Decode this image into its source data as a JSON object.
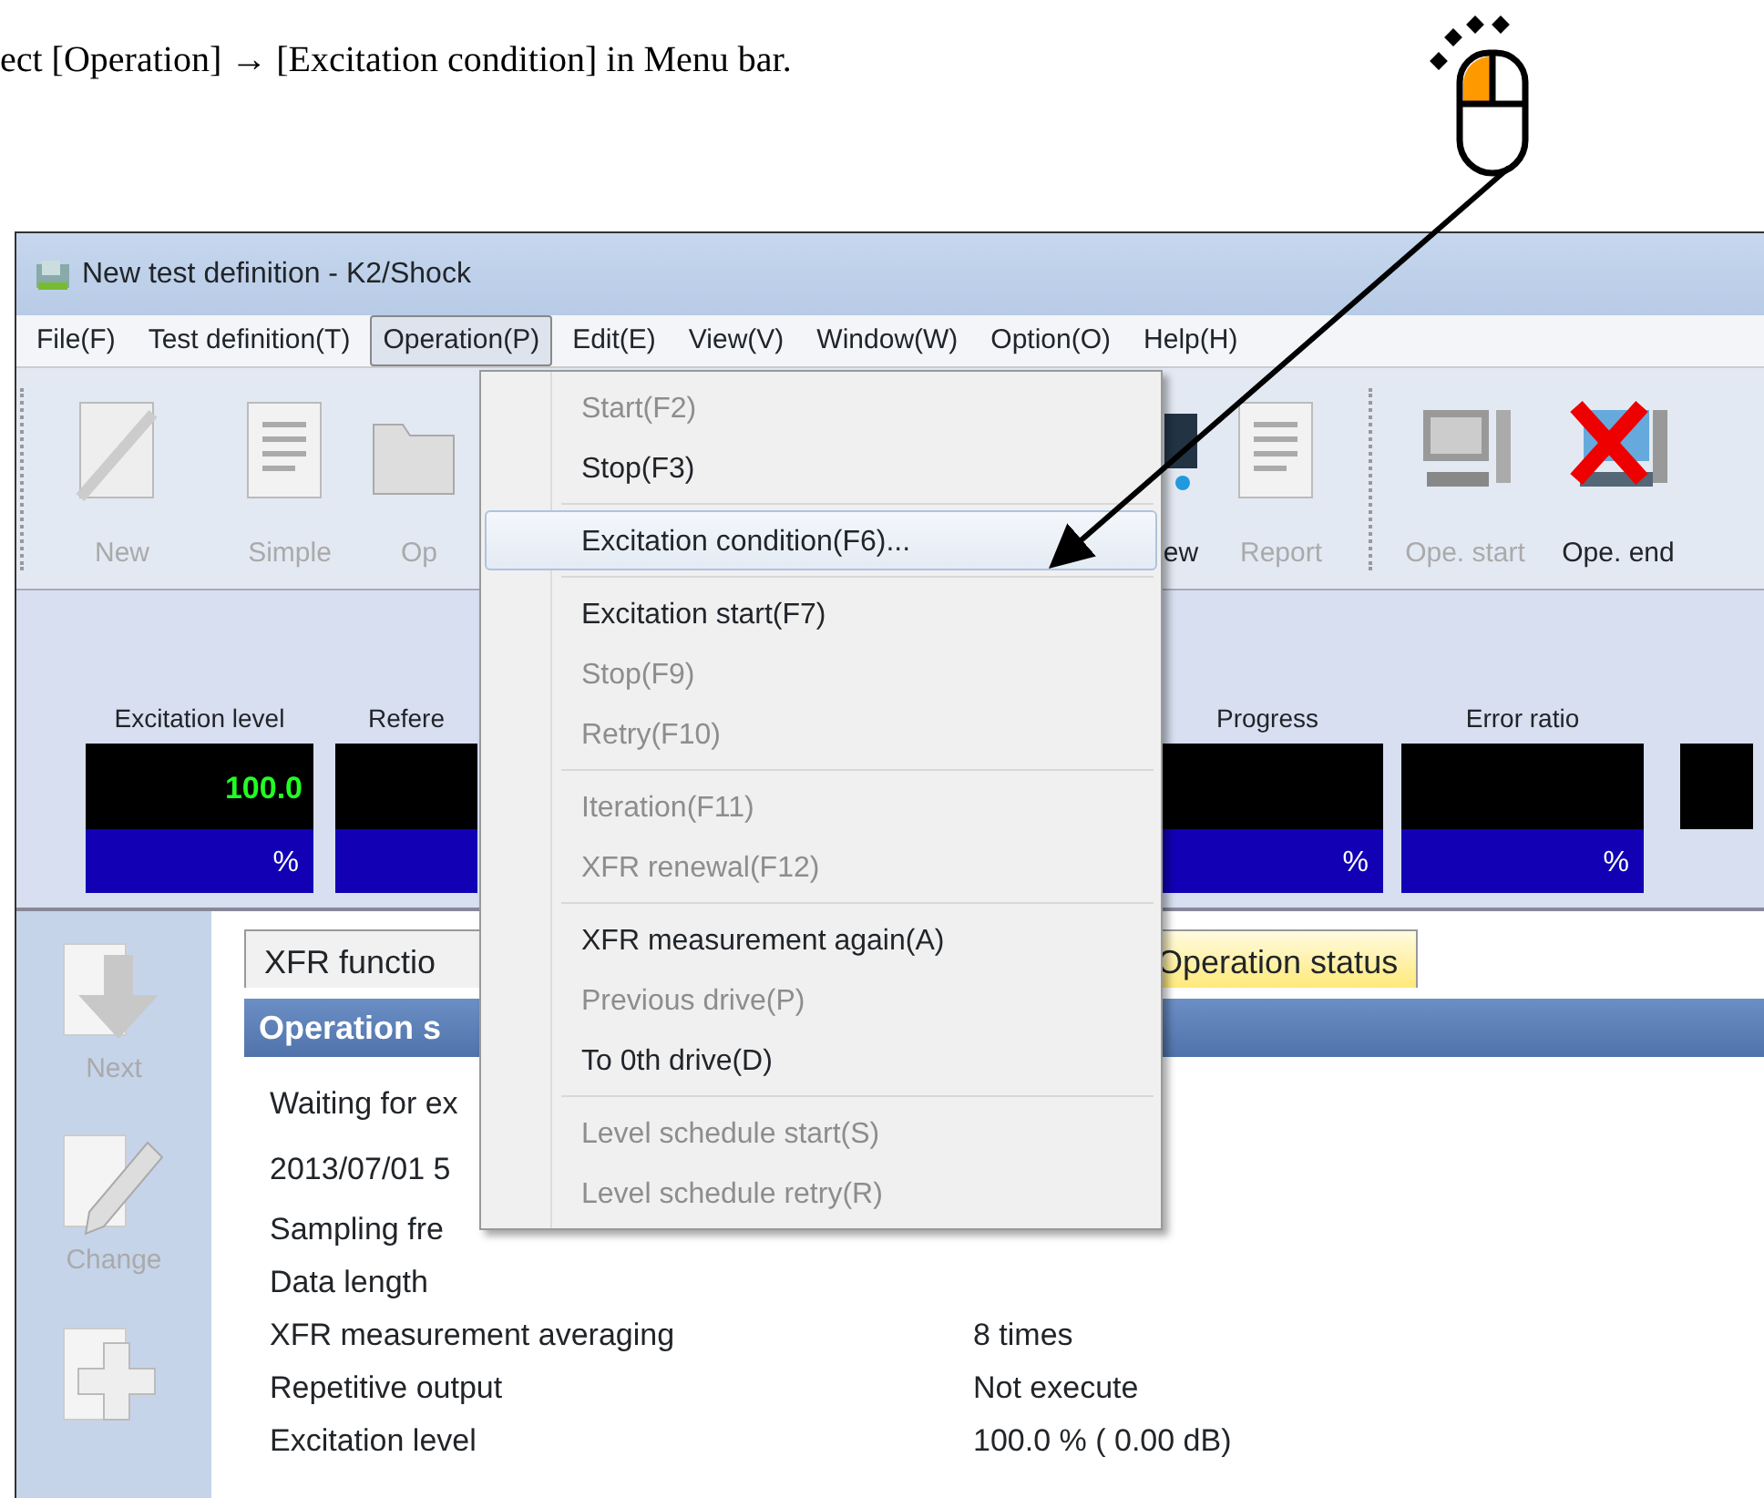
{
  "instruction": "ect [Operation] → [Excitation condition] in Menu bar.",
  "window": {
    "title": "New test definition - K2/Shock"
  },
  "menu_bar": [
    {
      "label": "File(F)",
      "selected": false
    },
    {
      "label": "Test definition(T)",
      "selected": false
    },
    {
      "label": "Operation(P)",
      "selected": true
    },
    {
      "label": "Edit(E)",
      "selected": false
    },
    {
      "label": "View(V)",
      "selected": false
    },
    {
      "label": "Window(W)",
      "selected": false
    },
    {
      "label": "Option(O)",
      "selected": false
    },
    {
      "label": "Help(H)",
      "selected": false
    }
  ],
  "toolbar": [
    {
      "label": "New",
      "disabled": true
    },
    {
      "label": "Simple",
      "disabled": true
    },
    {
      "label": "Op",
      "disabled": true
    },
    {
      "label": "ew",
      "disabled": false
    },
    {
      "label": "Report",
      "disabled": true
    },
    {
      "label": "Ope. start",
      "disabled": true
    },
    {
      "label": "Ope. end",
      "disabled": false
    }
  ],
  "meters": [
    {
      "kind": "full",
      "label": "Excitation level",
      "value": "100.0",
      "unit": "%"
    },
    {
      "kind": "blank",
      "label": "Refere"
    },
    {
      "kind": "full",
      "label": "Progress",
      "unit": "%"
    },
    {
      "kind": "full",
      "label": "Error ratio",
      "unit": "%"
    },
    {
      "kind": "display"
    }
  ],
  "sidebar": [
    {
      "label": "Next"
    },
    {
      "label": "Change"
    }
  ],
  "tabs": [
    {
      "label": "XFR functio",
      "selected": false
    },
    {
      "label": "Operation status",
      "selected": true
    }
  ],
  "panel": {
    "title": "Operation s",
    "rows": [
      {
        "label": "Waiting for ex"
      },
      {
        "label": "2013/07/01 5"
      },
      {
        "label": "Sampling fre"
      },
      {
        "label": "Data length"
      },
      {
        "label": "XFR measurement averaging",
        "value": "8 times"
      },
      {
        "label": "Repetitive output",
        "value": "Not execute"
      },
      {
        "label": "Excitation level",
        "value": "100.0 % ( 0.00 dB)"
      }
    ]
  },
  "dropdown": [
    {
      "kind": "item",
      "label": "Start(F2)",
      "disabled": true,
      "selected": false
    },
    {
      "kind": "item",
      "label": "Stop(F3)",
      "disabled": false,
      "selected": false
    },
    {
      "kind": "separator"
    },
    {
      "kind": "item",
      "label": "Excitation condition(F6)...",
      "disabled": false,
      "selected": true
    },
    {
      "kind": "separator"
    },
    {
      "kind": "item",
      "label": "Excitation start(F7)",
      "disabled": false,
      "selected": false
    },
    {
      "kind": "item",
      "label": "Stop(F9)",
      "disabled": true,
      "selected": false
    },
    {
      "kind": "item",
      "label": "Retry(F10)",
      "disabled": true,
      "selected": false
    },
    {
      "kind": "separator"
    },
    {
      "kind": "item",
      "label": "Iteration(F11)",
      "disabled": true,
      "selected": false
    },
    {
      "kind": "item",
      "label": "XFR renewal(F12)",
      "disabled": true,
      "selected": false
    },
    {
      "kind": "separator"
    },
    {
      "kind": "item",
      "label": "XFR measurement again(A)",
      "disabled": false,
      "selected": false
    },
    {
      "kind": "item",
      "label": "Previous drive(P)",
      "disabled": true,
      "selected": false
    },
    {
      "kind": "item",
      "label": "To 0th drive(D)",
      "disabled": false,
      "selected": false
    },
    {
      "kind": "separator"
    },
    {
      "kind": "item",
      "label": "Level schedule start(S)",
      "disabled": true,
      "selected": false
    },
    {
      "kind": "item",
      "label": "Level schedule retry(R)",
      "disabled": true,
      "selected": false
    }
  ]
}
